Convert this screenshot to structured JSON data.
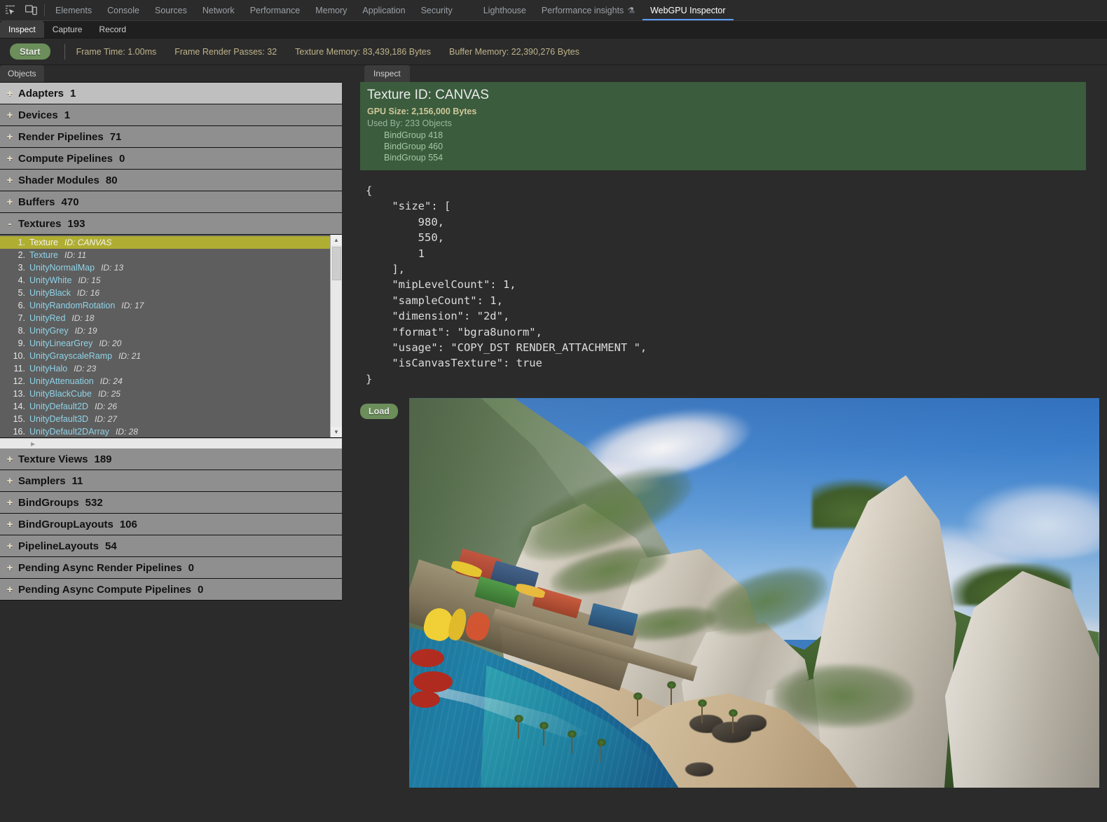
{
  "devtools": {
    "icons": [
      {
        "name": "inspect-element-icon"
      },
      {
        "name": "device-toolbar-icon"
      }
    ],
    "tabs": [
      {
        "label": "Elements",
        "active": false
      },
      {
        "label": "Console",
        "active": false
      },
      {
        "label": "Sources",
        "active": false
      },
      {
        "label": "Network",
        "active": false
      },
      {
        "label": "Performance",
        "active": false
      },
      {
        "label": "Memory",
        "active": false
      },
      {
        "label": "Application",
        "active": false
      },
      {
        "label": "Security",
        "active": false
      },
      {
        "label": "Lighthouse",
        "active": false
      },
      {
        "label": "Performance insights",
        "active": false,
        "icon": "flask-icon"
      },
      {
        "label": "WebGPU Inspector",
        "active": true
      }
    ]
  },
  "panel": {
    "subtabs": [
      {
        "label": "Inspect",
        "active": true
      },
      {
        "label": "Capture",
        "active": false
      },
      {
        "label": "Record",
        "active": false
      }
    ],
    "start_button": "Start",
    "stats": [
      {
        "label": "Frame Time: 1.00ms"
      },
      {
        "label": "Frame Render Passes: 32"
      },
      {
        "label": "Texture Memory: 83,439,186 Bytes"
      },
      {
        "label": "Buffer Memory: 22,390,276 Bytes"
      }
    ]
  },
  "sidebar": {
    "tab_label": "Objects",
    "groups": [
      {
        "twisty": "+",
        "label": "Adapters",
        "count": "1",
        "expanded": false,
        "highlighted": true
      },
      {
        "twisty": "+",
        "label": "Devices",
        "count": "1",
        "expanded": false,
        "highlighted": false
      },
      {
        "twisty": "+",
        "label": "Render Pipelines",
        "count": "71",
        "expanded": false,
        "highlighted": false
      },
      {
        "twisty": "+",
        "label": "Compute Pipelines",
        "count": "0",
        "expanded": false,
        "highlighted": false
      },
      {
        "twisty": "+",
        "label": "Shader Modules",
        "count": "80",
        "expanded": false,
        "highlighted": false
      },
      {
        "twisty": "+",
        "label": "Buffers",
        "count": "470",
        "expanded": false,
        "highlighted": false
      },
      {
        "twisty": "-",
        "label": "Textures",
        "count": "193",
        "expanded": true,
        "highlighted": false
      }
    ],
    "textures": [
      {
        "num": "1.",
        "name": "Texture",
        "id": "ID: CANVAS",
        "selected": true
      },
      {
        "num": "2.",
        "name": "Texture",
        "id": "ID: 11",
        "selected": false
      },
      {
        "num": "3.",
        "name": "UnityNormalMap",
        "id": "ID: 13",
        "selected": false
      },
      {
        "num": "4.",
        "name": "UnityWhite",
        "id": "ID: 15",
        "selected": false
      },
      {
        "num": "5.",
        "name": "UnityBlack",
        "id": "ID: 16",
        "selected": false
      },
      {
        "num": "6.",
        "name": "UnityRandomRotation",
        "id": "ID: 17",
        "selected": false
      },
      {
        "num": "7.",
        "name": "UnityRed",
        "id": "ID: 18",
        "selected": false
      },
      {
        "num": "8.",
        "name": "UnityGrey",
        "id": "ID: 19",
        "selected": false
      },
      {
        "num": "9.",
        "name": "UnityLinearGrey",
        "id": "ID: 20",
        "selected": false
      },
      {
        "num": "10.",
        "name": "UnityGrayscaleRamp",
        "id": "ID: 21",
        "selected": false
      },
      {
        "num": "11.",
        "name": "UnityHalo",
        "id": "ID: 23",
        "selected": false
      },
      {
        "num": "12.",
        "name": "UnityAttenuation",
        "id": "ID: 24",
        "selected": false
      },
      {
        "num": "13.",
        "name": "UnityBlackCube",
        "id": "ID: 25",
        "selected": false
      },
      {
        "num": "14.",
        "name": "UnityDefault2D",
        "id": "ID: 26",
        "selected": false
      },
      {
        "num": "15.",
        "name": "UnityDefault3D",
        "id": "ID: 27",
        "selected": false
      },
      {
        "num": "16.",
        "name": "UnityDefault2DArray",
        "id": "ID: 28",
        "selected": false
      }
    ],
    "groups_after": [
      {
        "twisty": "+",
        "label": "Texture Views",
        "count": "189"
      },
      {
        "twisty": "+",
        "label": "Samplers",
        "count": "11"
      },
      {
        "twisty": "+",
        "label": "BindGroups",
        "count": "532"
      },
      {
        "twisty": "+",
        "label": "BindGroupLayouts",
        "count": "106"
      },
      {
        "twisty": "+",
        "label": "PipelineLayouts",
        "count": "54"
      },
      {
        "twisty": "+",
        "label": "Pending Async Render Pipelines",
        "count": "0"
      },
      {
        "twisty": "+",
        "label": "Pending Async Compute Pipelines",
        "count": "0"
      }
    ]
  },
  "inspector": {
    "tab_label": "Inspect",
    "title": "Texture ID: CANVAS",
    "gpu_size": "GPU Size: 2,156,000 Bytes",
    "used_by": "Used By: 233 Objects",
    "bind_groups": [
      "BindGroup 418",
      "BindGroup 460",
      "BindGroup 554"
    ],
    "json_text": "{\n    \"size\": [\n        980,\n        550,\n        1\n    ],\n    \"mipLevelCount\": 1,\n    \"sampleCount\": 1,\n    \"dimension\": \"2d\",\n    \"format\": \"bgra8unorm\",\n    \"usage\": \"COPY_DST RENDER_ATTACHMENT \",\n    \"isCanvasTexture\": true\n}",
    "load_button": "Load",
    "preview_alt": "Tropical beach canvas texture preview: turquoise bay, sandy shore, colorful stilt huts on a pier, white limestone cliffs with green vegetation under a blue sky with clouds",
    "colors": {
      "header_bg": "#3b5c3d",
      "accent_green": "#6b8e5a",
      "selection_yellow": "#b0ae32",
      "tab_underline": "#5a9cf8"
    }
  }
}
